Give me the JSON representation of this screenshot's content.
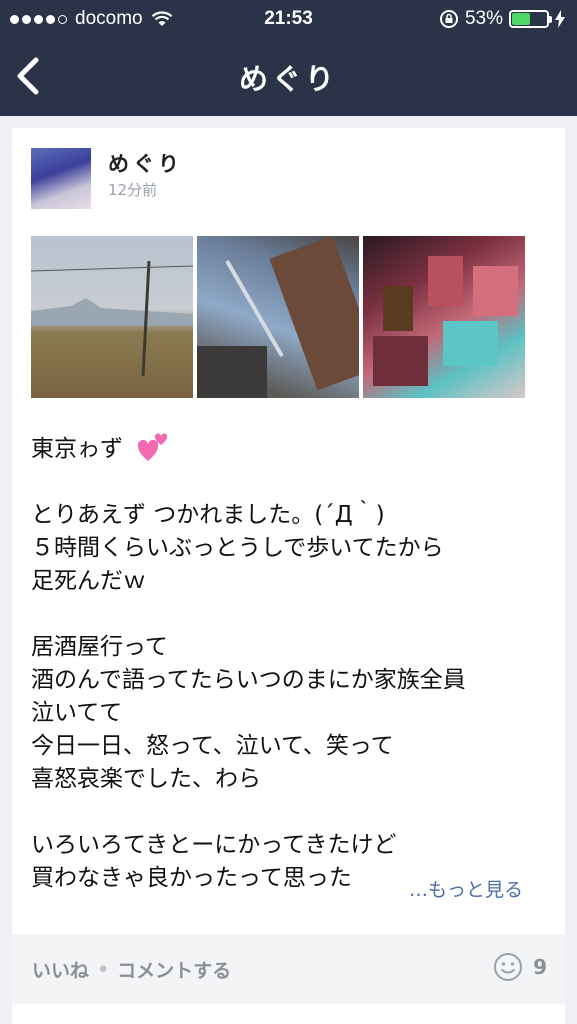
{
  "status": {
    "carrier": "docomo",
    "time": "21:53",
    "battery": "53%",
    "battery_level": 0.53
  },
  "nav": {
    "title": "めぐり"
  },
  "post": {
    "author": "めぐり",
    "time_ago": "12分前",
    "text": "東京ゎず\n\nとりあえず つかれました。(´Д｀)\n５時間くらいぶっとうしで歩いてたから\n足死んだｗ\n\n居酒屋行って\n酒のんで語ってたらいつのまにか家族全員\n泣いてて\n今日一日、怒って、泣いて、笑って\n喜怒哀楽でした、わら\n\nいろいろてきとーにかってきたけど\n買わなきゃ良かったって思った",
    "more": "…もっと見る",
    "like": "いいね",
    "separator": "•",
    "comment": "コメントする",
    "like_count": "9"
  },
  "colors": {
    "nav_bg": "#2b3348",
    "link": "#4b6ea6",
    "battery_green": "#4cd964"
  }
}
